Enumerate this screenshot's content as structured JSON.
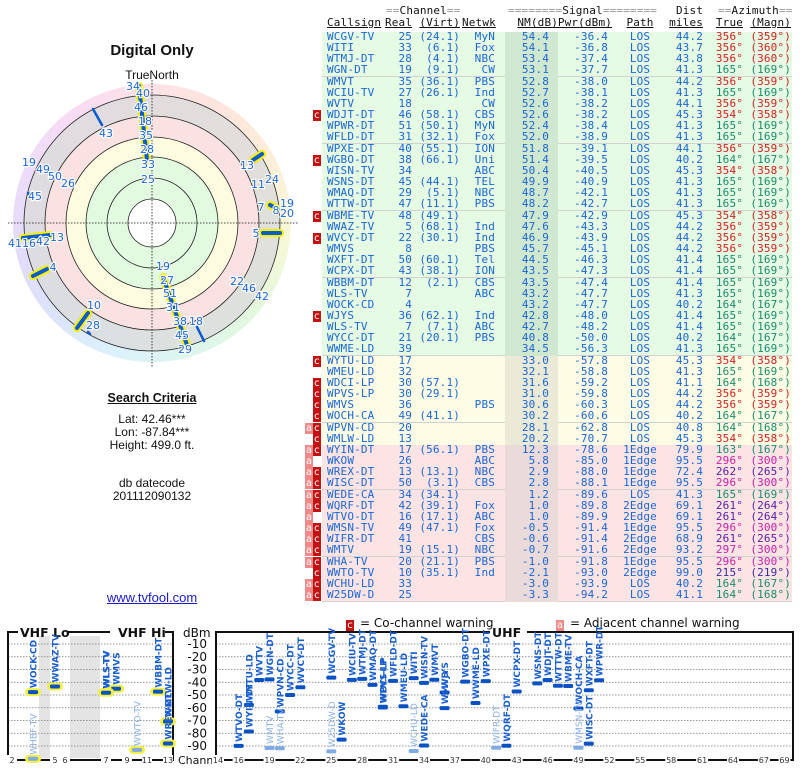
{
  "polar": {
    "title": "Digital Only",
    "north_label": "TrueNorth",
    "labels": [
      "34",
      "40",
      "46",
      "18",
      "35",
      "28",
      "33",
      "25",
      "43",
      "13",
      "11",
      "24",
      "7",
      "8",
      "19",
      "20",
      "5",
      "19",
      "27",
      "51",
      "31",
      "38",
      "45",
      "29",
      "18",
      "22",
      "46",
      "42",
      "10",
      "28",
      "4",
      "41",
      "16",
      "42",
      "13",
      "45",
      "19",
      "49",
      "50",
      "26"
    ]
  },
  "search": {
    "title": "Search Criteria",
    "lat": "Lat: 42.46***",
    "lon": "Lon: -87.84***",
    "height": "Height: 499.0 ft.",
    "db_label": "db datecode",
    "db_value": "201112090132",
    "site": "www.tvfool.com"
  },
  "table": {
    "group_channel": "Channel",
    "group_signal": "Signal",
    "group_dist": "Dist",
    "group_azimuth": "Azimuth",
    "columns": [
      "Callsign",
      "Real",
      "(Virt)",
      "Netwk",
      "NM(dB)",
      "Pwr(dBm)",
      "Path",
      "miles",
      "True",
      "(Magn)"
    ],
    "az_colors": {
      "north": "#d42020",
      "south": "#1a8c6c",
      "northwest": "#cc1fa8",
      "west": "#5a1aa8",
      "southwest": "#3a2aa0"
    },
    "band_colors": {
      "g": "#e6fbe4",
      "y": "#fdfde6",
      "p": "#fce4e4"
    },
    "rows": [
      [
        "",
        "WCGV-TV",
        "25",
        "(24.1)",
        "MyN",
        "54.4",
        "-36.4",
        "LOS",
        "44.2",
        "356°",
        "(359°)",
        "g"
      ],
      [
        "",
        "WITI",
        "33",
        "(6.1)",
        "Fox",
        "54.1",
        "-36.8",
        "LOS",
        "43.7",
        "356°",
        "(360°)",
        "g"
      ],
      [
        "",
        "WTMJ-DT",
        "28",
        "(4.1)",
        "NBC",
        "53.4",
        "-37.4",
        "LOS",
        "43.8",
        "356°",
        "(360°)",
        "g"
      ],
      [
        "",
        "WGN-DT",
        "19",
        "(9.1)",
        "CW",
        "53.1",
        "-37.7",
        "LOS",
        "41.3",
        "165°",
        "(169°)",
        "g"
      ],
      [
        "",
        "WMVT",
        "35",
        "(36.1)",
        "PBS",
        "52.8",
        "-38.0",
        "LOS",
        "44.2",
        "356°",
        "(359°)",
        "g"
      ],
      [
        "",
        "WCIU-TV",
        "27",
        "(26.1)",
        "Ind",
        "52.7",
        "-38.1",
        "LOS",
        "41.3",
        "165°",
        "(169°)",
        "g"
      ],
      [
        "",
        "WVTV",
        "18",
        "",
        "CW",
        "52.6",
        "-38.2",
        "LOS",
        "44.1",
        "356°",
        "(359°)",
        "g"
      ],
      [
        "c",
        "WDJT-DT",
        "46",
        "(58.1)",
        "CBS",
        "52.6",
        "-38.2",
        "LOS",
        "45.3",
        "354°",
        "(358°)",
        "g"
      ],
      [
        "",
        "WPWR-DT",
        "51",
        "(50.1)",
        "MyN",
        "52.4",
        "-38.4",
        "LOS",
        "41.3",
        "165°",
        "(169°)",
        "g"
      ],
      [
        "",
        "WFLD-DT",
        "31",
        "(32.1)",
        "Fox",
        "52.0",
        "-38.9",
        "LOS",
        "41.3",
        "165°",
        "(169°)",
        "g"
      ],
      [
        "",
        "WPXE-DT",
        "40",
        "(55.1)",
        "ION",
        "51.8",
        "-39.1",
        "LOS",
        "44.1",
        "356°",
        "(359°)",
        "g"
      ],
      [
        "c",
        "WGBO-DT",
        "38",
        "(66.1)",
        "Uni",
        "51.4",
        "-39.5",
        "LOS",
        "40.2",
        "164°",
        "(167°)",
        "g"
      ],
      [
        "",
        "WISN-TV",
        "34",
        "",
        "ABC",
        "50.4",
        "-40.5",
        "LOS",
        "45.3",
        "354°",
        "(358°)",
        "g"
      ],
      [
        "",
        "WSNS-DT",
        "45",
        "(44.1)",
        "TEL",
        "49.9",
        "-40.9",
        "LOS",
        "41.3",
        "165°",
        "(169°)",
        "g"
      ],
      [
        "",
        "WMAQ-DT",
        "29",
        "(5.1)",
        "NBC",
        "48.7",
        "-42.1",
        "LOS",
        "41.3",
        "165°",
        "(169°)",
        "g"
      ],
      [
        "",
        "WTTW-DT",
        "47",
        "(11.1)",
        "PBS",
        "48.2",
        "-42.7",
        "LOS",
        "41.3",
        "165°",
        "(169°)",
        "g"
      ],
      [
        "c",
        "WBME-TV",
        "48",
        "(49.1)",
        "",
        "47.9",
        "-42.9",
        "LOS",
        "45.3",
        "354°",
        "(358°)",
        "g"
      ],
      [
        "",
        "WWAZ-TV",
        "5",
        "(68.1)",
        "Ind",
        "47.6",
        "-43.3",
        "LOS",
        "44.2",
        "356°",
        "(359°)",
        "g"
      ],
      [
        "c",
        "WVCY-DT",
        "22",
        "(30.1)",
        "Ind",
        "46.9",
        "-43.9",
        "LOS",
        "44.2",
        "356°",
        "(359°)",
        "g"
      ],
      [
        "",
        "WMVS",
        "8",
        "",
        "PBS",
        "45.7",
        "-45.1",
        "LOS",
        "44.2",
        "356°",
        "(359°)",
        "g"
      ],
      [
        "",
        "WXFT-DT",
        "50",
        "(60.1)",
        "Tel",
        "44.5",
        "-46.3",
        "LOS",
        "41.4",
        "165°",
        "(169°)",
        "g"
      ],
      [
        "",
        "WCPX-DT",
        "43",
        "(38.1)",
        "ION",
        "43.5",
        "-47.3",
        "LOS",
        "41.4",
        "165°",
        "(169°)",
        "g"
      ],
      [
        "",
        "WBBM-DT",
        "12",
        "(2.1)",
        "CBS",
        "43.5",
        "-47.4",
        "LOS",
        "41.4",
        "165°",
        "(169°)",
        "g"
      ],
      [
        "",
        "WLS-TV",
        "7",
        "",
        "ABC",
        "43.2",
        "-47.7",
        "LOS",
        "41.3",
        "165°",
        "(169°)",
        "g"
      ],
      [
        "",
        "WOCK-CD",
        "4",
        "",
        "",
        "43.2",
        "-47.7",
        "LOS",
        "40.2",
        "164°",
        "(167°)",
        "g"
      ],
      [
        "c",
        "WJYS",
        "36",
        "(62.1)",
        "Ind",
        "42.8",
        "-48.0",
        "LOS",
        "41.4",
        "165°",
        "(169°)",
        "g"
      ],
      [
        "",
        "WLS-TV",
        "7",
        "(7.1)",
        "ABC",
        "42.7",
        "-48.2",
        "LOS",
        "41.4",
        "165°",
        "(169°)",
        "g"
      ],
      [
        "",
        "WYCC-DT",
        "21",
        "(20.1)",
        "PBS",
        "40.8",
        "-50.0",
        "LOS",
        "40.2",
        "164°",
        "(167°)",
        "g"
      ],
      [
        "",
        "WWME-LD",
        "39",
        "",
        "",
        "34.5",
        "-56.3",
        "LOS",
        "41.3",
        "165°",
        "(169°)",
        "g"
      ],
      [
        "c",
        "WYTU-LD",
        "17",
        "",
        "",
        "33.0",
        "-57.8",
        "LOS",
        "45.3",
        "354°",
        "(358°)",
        "y"
      ],
      [
        "",
        "WMEU-LD",
        "32",
        "",
        "",
        "32.1",
        "-58.8",
        "LOS",
        "41.3",
        "165°",
        "(169°)",
        "y"
      ],
      [
        "c",
        "WDCI-LP",
        "30",
        "(57.1)",
        "",
        "31.6",
        "-59.2",
        "LOS",
        "41.1",
        "164°",
        "(168°)",
        "y"
      ],
      [
        "c",
        "WPVS-LP",
        "30",
        "(29.1)",
        "",
        "31.0",
        "-59.8",
        "LOS",
        "44.2",
        "356°",
        "(359°)",
        "y"
      ],
      [
        "c",
        "WMVS",
        "36",
        "",
        "PBS",
        "30.6",
        "-60.3",
        "LOS",
        "44.2",
        "356°",
        "(359°)",
        "y"
      ],
      [
        "c",
        "WOCH-CA",
        "49",
        "(41.1)",
        "",
        "30.2",
        "-60.6",
        "LOS",
        "40.2",
        "164°",
        "(167°)",
        "y"
      ],
      [
        "ac",
        "WPVN-CD",
        "20",
        "",
        "",
        "28.1",
        "-62.8",
        "LOS",
        "40.8",
        "164°",
        "(168°)",
        "y"
      ],
      [
        "c",
        "WMLW-LD",
        "13",
        "",
        "",
        "20.2",
        "-70.7",
        "LOS",
        "45.3",
        "354°",
        "(358°)",
        "y"
      ],
      [
        "ac",
        "WYIN-DT",
        "17",
        "(56.1)",
        "PBS",
        "12.3",
        "-78.6",
        "1Edge",
        "79.9",
        "163°",
        "(167°)",
        "p"
      ],
      [
        "a",
        "WKOW",
        "26",
        "",
        "ABC",
        "5.8",
        "-85.0",
        "1Edge",
        "95.5",
        "296°",
        "(300°)",
        "p"
      ],
      [
        "ac",
        "WREX-DT",
        "13",
        "(13.1)",
        "NBC",
        "2.9",
        "-88.0",
        "1Edge",
        "72.4",
        "262°",
        "(265°)",
        "p"
      ],
      [
        "ac",
        "WISC-DT",
        "50",
        "(3.1)",
        "CBS",
        "2.8",
        "-88.1",
        "1Edge",
        "95.5",
        "296°",
        "(300°)",
        "p"
      ],
      [
        "ac",
        "WEDE-CA",
        "34",
        "(34.1)",
        "",
        "1.2",
        "-89.6",
        "LOS",
        "41.3",
        "165°",
        "(169°)",
        "p"
      ],
      [
        "ac",
        "WQRF-DT",
        "42",
        "(39.1)",
        "Fox",
        "1.0",
        "-89.8",
        "2Edge",
        "69.1",
        "261°",
        "(264°)",
        "p"
      ],
      [
        "a",
        "WTVO-DT",
        "16",
        "(17.1)",
        "ABC",
        "1.0",
        "-89.9",
        "2Edge",
        "69.1",
        "261°",
        "(264°)",
        "p"
      ],
      [
        "ac",
        "WMSN-TV",
        "49",
        "(47.1)",
        "Fox",
        "-0.5",
        "-91.4",
        "1Edge",
        "95.5",
        "296°",
        "(300°)",
        "p"
      ],
      [
        "ac",
        "WIFR-DT",
        "41",
        "",
        "CBS",
        "-0.6",
        "-91.4",
        "2Edge",
        "68.9",
        "261°",
        "(265°)",
        "p"
      ],
      [
        "ac",
        "WMTV",
        "19",
        "(15.1)",
        "NBC",
        "-0.7",
        "-91.6",
        "2Edge",
        "93.2",
        "297°",
        "(300°)",
        "p"
      ],
      [
        "ac",
        "WHA-TV",
        "20",
        "(21.1)",
        "PBS",
        "-1.0",
        "-91.8",
        "1Edge",
        "95.5",
        "296°",
        "(300°)",
        "p"
      ],
      [
        "c",
        "WWTO-TV",
        "10",
        "(35.1)",
        "Ind",
        "-2.1",
        "-93.0",
        "2Edge",
        "99.0",
        "215°",
        "(219°)",
        "p"
      ],
      [
        "ac",
        "WCHU-LD",
        "33",
        "",
        "",
        "-3.0",
        "-93.9",
        "LOS",
        "40.2",
        "164°",
        "(167°)",
        "p"
      ],
      [
        "ac",
        "W25DW-D",
        "25",
        "",
        "",
        "-3.3",
        "-94.2",
        "LOS",
        "41.1",
        "164°",
        "(168°)",
        "p"
      ]
    ]
  },
  "legend": {
    "co_icon": "c",
    "co_label": "= Co-channel warning",
    "adj_icon": "a",
    "adj_label": "= Adjacent channel warning"
  },
  "spectrum": {
    "vhf_lo": "VHF Lo",
    "vhf_hi": "VHF Hi",
    "uhf": "UHF",
    "unit": "dBm",
    "channel_label": "Channel",
    "db_ticks": [
      "-10",
      "-20",
      "-30",
      "-40",
      "-50",
      "-60",
      "-70",
      "-80",
      "-90"
    ],
    "vhf_ticks": [
      "2",
      "4",
      "5",
      "6",
      "7",
      "9",
      "11",
      "13"
    ],
    "uhf_ticks": [
      "14",
      "16",
      "19",
      "22",
      "25",
      "28",
      "31",
      "34",
      "37",
      "40",
      "43",
      "46",
      "49",
      "52",
      "55",
      "58",
      "61",
      "64",
      "67",
      "69"
    ],
    "extra_stations": [
      [
        "WHBF-TV",
        "4",
        "-100"
      ]
    ],
    "strong_color": "#0a52c4",
    "weak_color": "#80aae4",
    "vhf_highlight": "#f4f040"
  }
}
